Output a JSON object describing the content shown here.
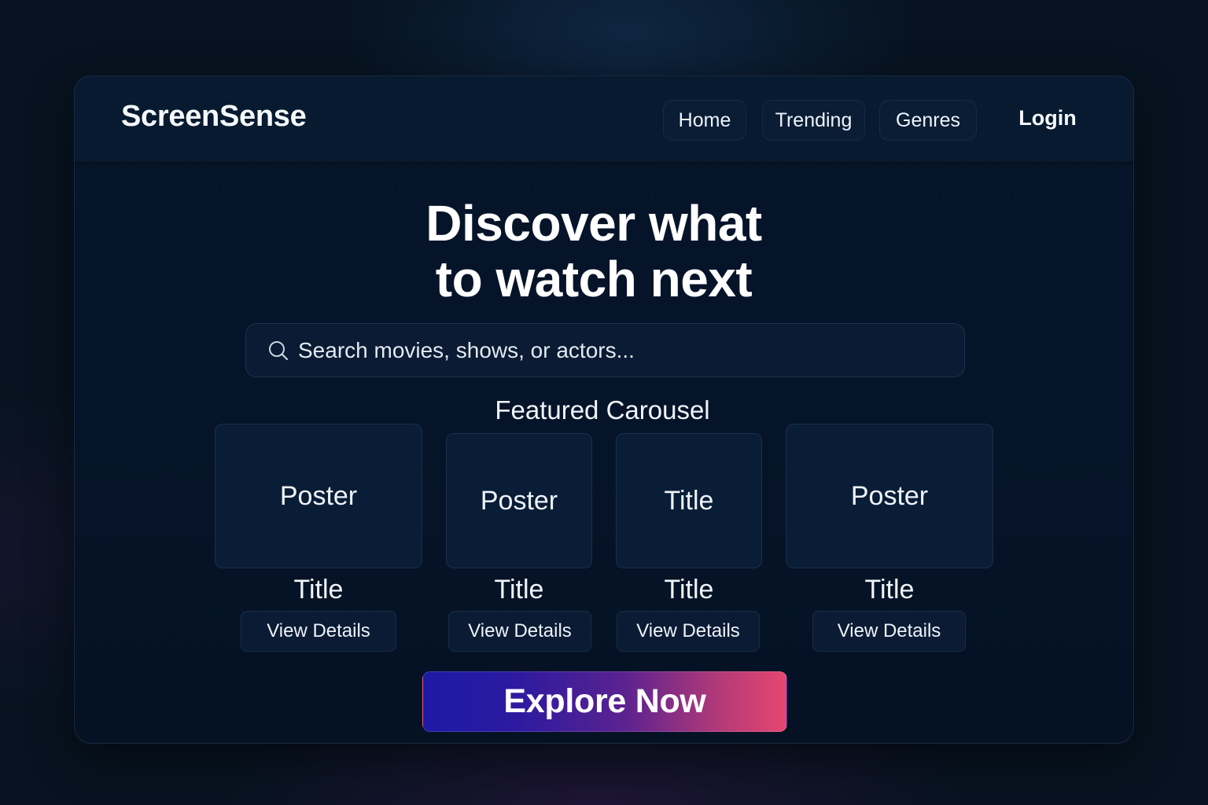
{
  "brand": {
    "name": "ScreenSense"
  },
  "nav": {
    "home": "Home",
    "trending": "Trending",
    "genres": "Genres",
    "login": "Login"
  },
  "hero": {
    "line1": "Discover what",
    "line2": "to watch next"
  },
  "search": {
    "placeholder": "Search movies, shows, or actors...",
    "icon": "search-icon"
  },
  "carousel": {
    "title": "Featured Carousel",
    "cards": [
      {
        "poster_label": "Poster",
        "title": "Title",
        "button": "View Details"
      },
      {
        "poster_label": "Poster",
        "title": "Title",
        "button": "View Details"
      },
      {
        "poster_label": "Title",
        "title": "Title",
        "button": "View Details"
      },
      {
        "poster_label": "Poster",
        "title": "Title",
        "button": "View Details"
      }
    ]
  },
  "cta": {
    "label": "Explore Now"
  },
  "colors": {
    "background": "#071320",
    "panel": "#061529",
    "cta_start": "#1c1aa5",
    "cta_end": "#e8466f"
  }
}
